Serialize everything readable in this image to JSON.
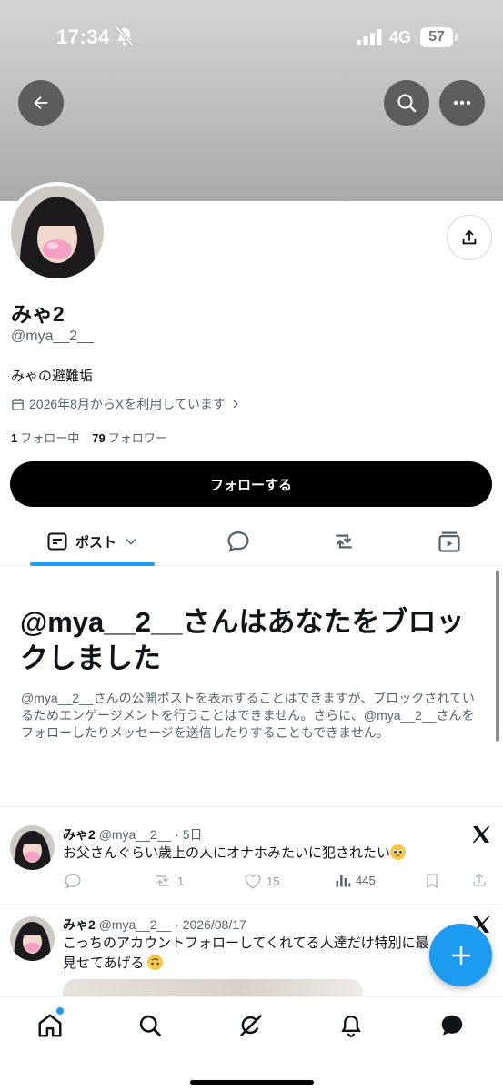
{
  "status_bar": {
    "time": "17:34",
    "network": "4G",
    "battery": "57"
  },
  "header": {
    "back_icon": "arrow-left-icon",
    "search_icon": "search-icon",
    "more_icon": "more-horizontal-icon"
  },
  "profile": {
    "display_name": "みゃ2",
    "handle": "@mya__2__",
    "bio": "みゃの避難垢",
    "joined": "2026年8月からXを利用しています",
    "following_count": "1",
    "following_label": "フォロー中",
    "followers_count": "79",
    "followers_label": "フォロワー",
    "follow_button": "フォローする"
  },
  "tabs": {
    "posts_label": "ポスト",
    "icons": [
      "posts-icon",
      "replies-icon",
      "reposts-icon",
      "media-icon"
    ]
  },
  "blocked": {
    "title": "@mya__2__さんはあなたをブロックしました",
    "description": "@mya__2__さんの公開ポストを表示することはできますが、ブロックされているためエンゲージメントを行うことはできません。さらに、@mya__2__さんをフォローしたりメッセージを送信したりすることもできません。"
  },
  "tweets": [
    {
      "name": "みゃ2",
      "meta": "@mya__2__ · 5日",
      "text": "お父さんぐらい歳上の人にオナホみたいに犯されたい",
      "emoji": "pleading-face-emoji",
      "reply_count": "",
      "repost_count": "1",
      "like_count": "15",
      "view_count": "445"
    },
    {
      "name": "みゃ2",
      "meta": "@mya__2__ · 2026/08/17",
      "text": "こっちのアカウントフォローしてくれてる人達だけ特別に最",
      "text_line2": "見せてあげる",
      "emoji": "upside-down-face-emoji"
    }
  ],
  "colors": {
    "accent": "#1d9bf0",
    "text": "#0f1419",
    "secondary": "#536471"
  }
}
